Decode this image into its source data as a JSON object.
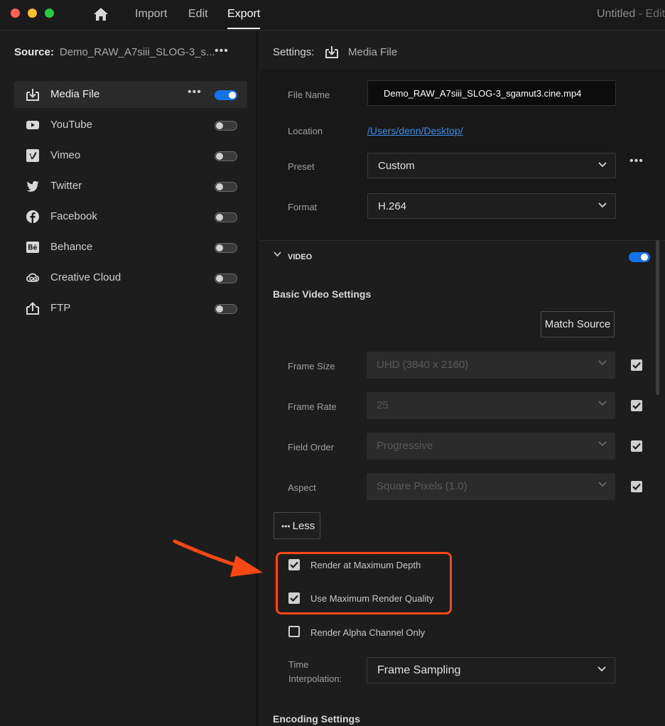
{
  "titlebar": {
    "nav": {
      "import": "Import",
      "edit": "Edit",
      "export": "Export"
    },
    "document_title": "Untitled",
    "document_suffix": " - Edit"
  },
  "source": {
    "label": "Source:",
    "value": "Demo_RAW_A7siii_SLOG-3_s...",
    "more": "•••"
  },
  "destinations": [
    {
      "label": "Media File",
      "icon": "download-icon",
      "enabled": true,
      "selected": true,
      "more": "•••"
    },
    {
      "label": "YouTube",
      "icon": "youtube-icon",
      "enabled": false
    },
    {
      "label": "Vimeo",
      "icon": "vimeo-icon",
      "enabled": false
    },
    {
      "label": "Twitter",
      "icon": "twitter-icon",
      "enabled": false
    },
    {
      "label": "Facebook",
      "icon": "facebook-icon",
      "enabled": false
    },
    {
      "label": "Behance",
      "icon": "behance-icon",
      "enabled": false
    },
    {
      "label": "Creative Cloud",
      "icon": "creative-cloud-icon",
      "enabled": false
    },
    {
      "label": "FTP",
      "icon": "upload-icon",
      "enabled": false
    }
  ],
  "settings": {
    "label": "Settings:",
    "destination": "Media File",
    "file_name_label": "File Name",
    "file_name": "Demo_RAW_A7siii_SLOG-3_sgamut3.cine.mp4",
    "location_label": "Location",
    "location": "/Users/denn/Desktop/",
    "preset_label": "Preset",
    "preset": "Custom",
    "preset_more": "•••",
    "format_label": "Format",
    "format": "H.264"
  },
  "video": {
    "section_label": "VIDEO",
    "enabled": true,
    "basic_title": "Basic Video Settings",
    "match_source": "Match Source",
    "frame_size_label": "Frame Size",
    "frame_size": "UHD (3840 x 2160)",
    "frame_rate_label": "Frame Rate",
    "frame_rate": "25",
    "field_order_label": "Field Order",
    "field_order": "Progressive",
    "aspect_label": "Aspect",
    "aspect": "Square Pixels (1.0)",
    "less_dots": "•••",
    "less_label": "Less",
    "render_max_depth": "Render at Maximum Depth",
    "render_max_depth_checked": true,
    "max_render_quality": "Use Maximum Render Quality",
    "max_render_quality_checked": true,
    "render_alpha": "Render Alpha Channel Only",
    "render_alpha_checked": false,
    "time_interp_label_1": "Time",
    "time_interp_label_2": "Interpolation:",
    "time_interp": "Frame Sampling"
  },
  "encoding_title": "Encoding Settings",
  "colors": {
    "accent_blue": "#1473e6",
    "link_blue": "#3a8ee8",
    "highlight_orange": "#fa4714"
  }
}
